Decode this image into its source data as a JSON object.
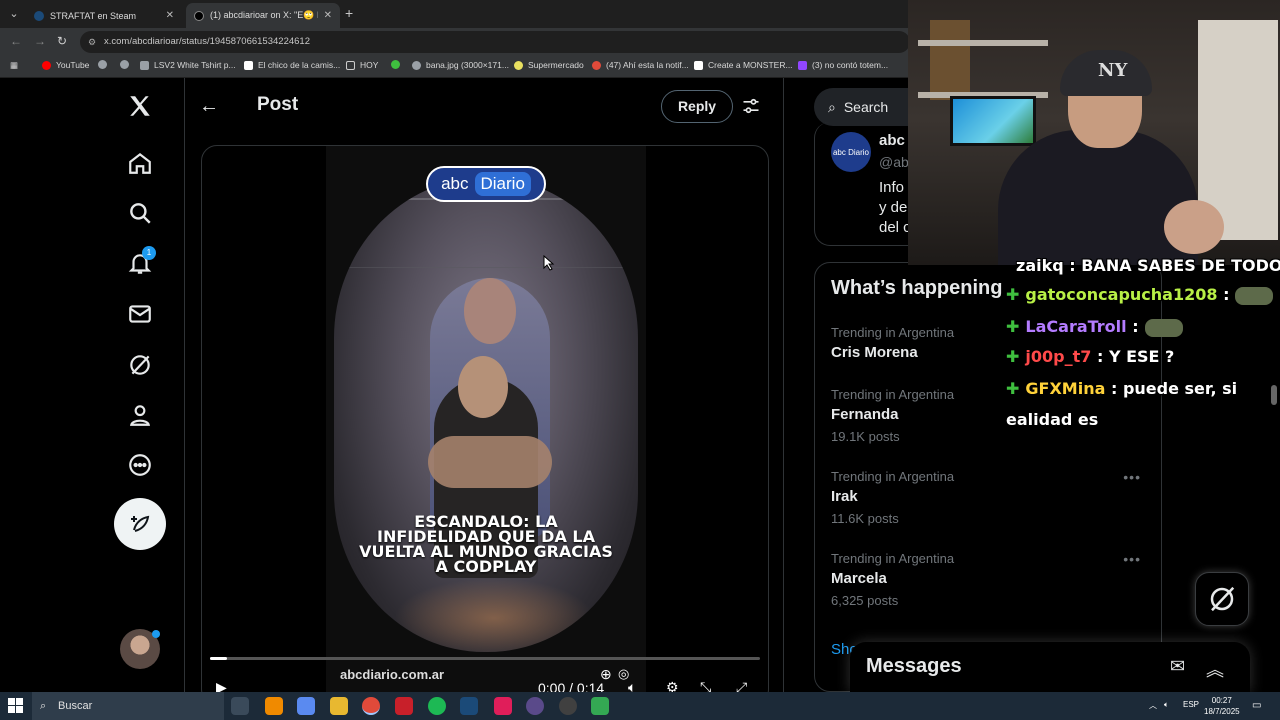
{
  "browser": {
    "tabs": [
      {
        "title": "STRAFTAT en Steam",
        "active": false
      },
      {
        "title": "(1) abcdiarioar on X: \"E🙄 ESCÁ",
        "active": true
      }
    ],
    "url": "x.com/abcdiarioar/status/1945870661534224612",
    "bookmarks": [
      {
        "label": "YouTube",
        "color": "#ff0000"
      },
      {
        "label": "",
        "color": "#9aa0a6"
      },
      {
        "label": "LSV2 White Tshirt p...",
        "color": "#9aa0a6"
      },
      {
        "label": "El chico de la camis...",
        "color": "#ffffff"
      },
      {
        "label": "HOY",
        "color": "#9aa0a6"
      },
      {
        "label": "",
        "color": "#3fbf3f"
      },
      {
        "label": "bana.jpg (3000×171...",
        "color": "#9aa0a6"
      },
      {
        "label": "Supermercado",
        "color": "#e8e060"
      },
      {
        "label": "(47) Ahí esta la notif...",
        "color": "#e04a3a"
      },
      {
        "label": "Create a MONSTER...",
        "color": "#ffffff"
      },
      {
        "label": "(3) no contó totem...",
        "color": "#9146ff"
      }
    ]
  },
  "xnav": {
    "notifications_badge": "1",
    "items": [
      "home-icon",
      "explore-icon",
      "notifications-icon",
      "messages-icon",
      "grok-icon",
      "profile-icon",
      "more-icon"
    ]
  },
  "post_header": {
    "title": "Post",
    "reply_label": "Reply"
  },
  "video": {
    "logo_left": "abc",
    "logo_right": "Diario",
    "caption": "ESCANDALO: LA INFIDELIDAD QUE DA LA VUELTA AL MUNDO GRACIAS A CODPLAY",
    "watermark": "abcdiario.com.ar",
    "time": "0:00 / 0:14",
    "progress": 0.03
  },
  "right": {
    "search_placeholder": "Search",
    "profile": {
      "avatar_text": "abc Diario",
      "name": "abc",
      "handle": "@ab",
      "bio": [
        "Info",
        "y de",
        "del c"
      ]
    },
    "trends_title": "What’s happening",
    "trends": [
      {
        "meta": "Trending in Argentina",
        "name": "Cris Morena",
        "count": ""
      },
      {
        "meta": "Trending in Argentina",
        "name": "Fernanda",
        "count": "19.1K posts"
      },
      {
        "meta": "Trending in Argentina",
        "name": "Irak",
        "count": "11.6K posts"
      },
      {
        "meta": "Trending in Argentina",
        "name": "Marcela",
        "count": "6,325 posts"
      }
    ],
    "show_more": "Sho"
  },
  "messages": {
    "title": "Messages"
  },
  "stream_chat": [
    {
      "user": "zaikq",
      "color": "#ffffff",
      "text": ": BANA SABES DE TODO",
      "diamond": false,
      "emote": false
    },
    {
      "user": "gatoconcapucha1208",
      "color": "#b8f046",
      "text": ":",
      "diamond": true,
      "emote": true
    },
    {
      "user": "LaCaraTroll",
      "color": "#b47cff",
      "text": ":",
      "diamond": true,
      "emote": true
    },
    {
      "user": "j00p_t7",
      "color": "#ff4a4a",
      "text": ": Y ESE ?",
      "diamond": true,
      "emote": false
    },
    {
      "user": "GFXMina",
      "color": "#ffd23a",
      "text": ": puede ser, si",
      "diamond": true,
      "emote": false
    },
    {
      "user": "",
      "color": "#ffffff",
      "text": "ealidad es",
      "diamond": false,
      "emote": false
    }
  ],
  "webcam_cap_text": "NY",
  "taskbar": {
    "search_placeholder": "Buscar",
    "lang": "ESP",
    "time": "00:27",
    "date": "18/7/2025",
    "apps": [
      {
        "name": "task-view-icon",
        "color": "#3a4a5a"
      },
      {
        "name": "vlc-icon",
        "color": "#f08a00"
      },
      {
        "name": "copilot-icon",
        "color": "#5a8af0"
      },
      {
        "name": "file-explorer-icon",
        "color": "#e8b830"
      },
      {
        "name": "chrome-icon",
        "color": "#e04a3a"
      },
      {
        "name": "voicemod-icon",
        "color": "#c8202a"
      },
      {
        "name": "spotify-icon",
        "color": "#1db954"
      },
      {
        "name": "steam-icon",
        "color": "#1b4a78"
      },
      {
        "name": "slack-icon",
        "color": "#e01e5a"
      },
      {
        "name": "obs-icon",
        "color": "#5a4a8a"
      },
      {
        "name": "streamlabs-icon",
        "color": "#404040"
      },
      {
        "name": "drive-icon",
        "color": "#34a853"
      }
    ]
  }
}
